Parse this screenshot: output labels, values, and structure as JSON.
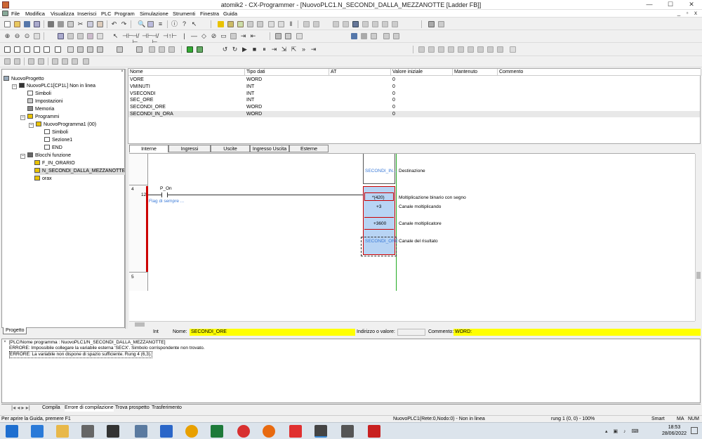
{
  "window": {
    "title": "atomik2 - CX-Programmer - [NuovoPLC1.N_SECONDI_DALLA_MEZZANOTTE [Ladder FB]]",
    "min_glyph": "—",
    "max_glyph": "☐",
    "close_glyph": "✕"
  },
  "menu": [
    "File",
    "Modifica",
    "Visualizza",
    "Inserisci",
    "PLC",
    "Program",
    "Simulazione",
    "Strumenti",
    "Finestra",
    "Guida"
  ],
  "mdi_controls": {
    "min": "_",
    "restore": "▫",
    "close": "x"
  },
  "tree": {
    "project": "NuovoProgetto",
    "plc": "NuovoPLC1[CP1L] Non in linea",
    "symbols": "Simboli",
    "settings": "Impostazioni",
    "memory": "Memoria",
    "programs": "Programmi",
    "program1": "NuovoProgramma1 (00)",
    "p_symbols": "Simboli",
    "section1": "Sezione1",
    "end": "END",
    "fblocks": "Blocchi funzione",
    "fb1": "F_IN_ORARIO",
    "fb2": "N_SECONDI_DALLA_MEZZANOTTE",
    "fb3": "orax",
    "tab": "Progetto"
  },
  "var_table": {
    "headers": [
      "Nome",
      "Tipo dati",
      "AT",
      "Valore iniziale",
      "Mantenuto",
      "Commento"
    ],
    "rows": [
      [
        "VORE",
        "WORD",
        "",
        "0"
      ],
      [
        "VMINUTI",
        "INT",
        "",
        "0"
      ],
      [
        "VSECONDI",
        "INT",
        "",
        "0"
      ],
      [
        "SEC_ORE",
        "INT",
        "",
        "0"
      ],
      [
        "SECONDI_ORE",
        "WORD",
        "",
        "0"
      ],
      [
        "SECONDI_IN_ORA",
        "WORD",
        "",
        "0"
      ]
    ],
    "tabs": [
      "Interne",
      "Ingressi",
      "Uscite",
      "Ingresso Uscita",
      "Esterne"
    ]
  },
  "ladder": {
    "rung4_num": "4",
    "rung4_step": "12",
    "rung5_num": "5",
    "contact_name": "P_On",
    "contact_comment": "Flag di sempre ...",
    "top_box_operand": "SECONDI_IN...",
    "top_box_desc": "Destinazione",
    "instr": "*(420)",
    "instr_desc": "Moltiplicazione binario con segno",
    "op1": "+3",
    "op1_desc": "Canale moltiplicando",
    "op2": "+3600",
    "op2_desc": "Canale moltiplicatore",
    "op3": "SECONDI_ORE",
    "op3_desc": "Canale del risultato"
  },
  "info_bar": {
    "int_label": "Int",
    "name_label": "Nome:",
    "name_value": "SECONDI_ORE",
    "addr_label": "Indirizzo o valore:",
    "comment_label": "Commento:",
    "comment_value": "WORD:"
  },
  "output": {
    "lines": [
      "[PLC/Nome programma : NuovoPLC1/N_SECONDI_DALLA_MEZZANOTTE]",
      "ERRORE: Impossibile collegare la variabile esterna 'SECX'. Simbolo corrispondente non trovato.",
      "ERRORE: La variabile non dispone di spazio sufficiente. Rung 4 (6,3)."
    ],
    "tabs": [
      "Compila",
      "Errore di compilazione",
      "Trova prospetto",
      "Trasferimento"
    ]
  },
  "status": {
    "help": "Per aprire la Guida, premere F1",
    "plc": "NuovoPLC1(Rete:0,Nodo:0) - Non in linea",
    "rung": "rung 1 (0, 0)  - 100%",
    "smart": "Smart",
    "ma": "MA",
    "num": "NUM"
  },
  "taskbar": {
    "time": "18:53",
    "date": "28/06/2022"
  },
  "colors": {
    "highlight_yellow": "#ffff00",
    "ladder_red": "#cc0000",
    "ladder_green": "#22aa22",
    "instr_fill": "#b8d4f4",
    "comment_blue": "#3a7ad8"
  }
}
